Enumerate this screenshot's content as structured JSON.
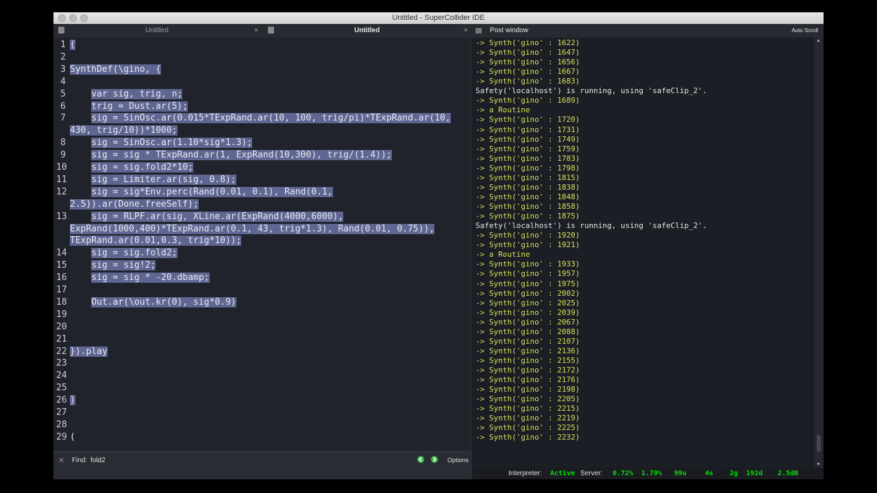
{
  "window": {
    "title": "Untitled - SuperCollider IDE"
  },
  "tabs": [
    {
      "label": "Untitled",
      "close": "×"
    },
    {
      "label": "Untitled",
      "close": "×"
    }
  ],
  "editor": {
    "lines": [
      {
        "n": "1",
        "indent": "",
        "text": "("
      },
      {
        "n": "2",
        "indent": "",
        "text": ""
      },
      {
        "n": "3",
        "indent": "",
        "text": "SynthDef(\\gino, {"
      },
      {
        "n": "4",
        "indent": "",
        "text": ""
      },
      {
        "n": "5",
        "indent": "    ",
        "text": "var sig, trig, n;"
      },
      {
        "n": "6",
        "indent": "    ",
        "text": "trig = Dust.ar(5);"
      },
      {
        "n": "7",
        "indent": "    ",
        "text": "sig = SinOsc.ar(0.015*TExpRand.ar(10, 100, trig/pi)*TExpRand.ar(10,"
      },
      {
        "n": "",
        "indent": "",
        "text": "430, trig/10))*1000;"
      },
      {
        "n": "8",
        "indent": "    ",
        "text": "sig = SinOsc.ar(1.10*sig*1.3);"
      },
      {
        "n": "9",
        "indent": "    ",
        "text": "sig = sig * TExpRand.ar(1, ExpRand(10,300), trig/(1.4));"
      },
      {
        "n": "10",
        "indent": "    ",
        "text": "sig = sig.fold2*10;"
      },
      {
        "n": "11",
        "indent": "    ",
        "text": "sig = Limiter.ar(sig, 0.8);"
      },
      {
        "n": "12",
        "indent": "    ",
        "text": "sig = sig*Env.perc(Rand(0.01, 0.1), Rand(0.1,"
      },
      {
        "n": "",
        "indent": "",
        "text": "2.5)).ar(Done.freeSelf);"
      },
      {
        "n": "13",
        "indent": "    ",
        "text": "sig = RLPF.ar(sig, XLine.ar(ExpRand(4000,6000),"
      },
      {
        "n": "",
        "indent": "",
        "text": "ExpRand(1000,400)*TExpRand.ar(0.1, 43, trig*1.3), Rand(0.01, 0.75)),"
      },
      {
        "n": "",
        "indent": "",
        "text": "TExpRand.ar(0.01,0.3, trig*10));"
      },
      {
        "n": "14",
        "indent": "    ",
        "text": "sig = sig.fold2;"
      },
      {
        "n": "15",
        "indent": "    ",
        "text": "sig = sig!2;"
      },
      {
        "n": "16",
        "indent": "    ",
        "text": "sig = sig * -20.dbamp;"
      },
      {
        "n": "17",
        "indent": "    ",
        "text": ""
      },
      {
        "n": "18",
        "indent": "    ",
        "text": "Out.ar(\\out.kr(0), sig*0.9)"
      },
      {
        "n": "19",
        "indent": "    ",
        "text": ""
      },
      {
        "n": "20",
        "indent": "    ",
        "text": ""
      },
      {
        "n": "21",
        "indent": "    ",
        "text": ""
      },
      {
        "n": "22",
        "indent": "",
        "text": "}).play"
      },
      {
        "n": "23",
        "indent": "",
        "text": ""
      },
      {
        "n": "24",
        "indent": "",
        "text": ""
      },
      {
        "n": "25",
        "indent": "",
        "text": ""
      },
      {
        "n": "26",
        "indent": "",
        "text": ")"
      },
      {
        "n": "27",
        "indent": "",
        "text": ""
      },
      {
        "n": "28",
        "indent": "",
        "text": ""
      },
      {
        "n": "29",
        "indent": "",
        "text": "("
      }
    ]
  },
  "find": {
    "label": "Find:",
    "value": "fold2",
    "options_label": "Options"
  },
  "post": {
    "title": "Post window",
    "auto_scroll": "Auto Scroll",
    "lines": [
      "-> Synth('gino' : 1622)",
      "-> Synth('gino' : 1647)",
      "-> Synth('gino' : 1656)",
      "-> Synth('gino' : 1667)",
      "-> Synth('gino' : 1683)",
      "Safety('localhost') is running, using 'safeClip_2'.",
      "-> Synth('gino' : 1689)",
      "-> a Routine",
      "-> Synth('gino' : 1720)",
      "-> Synth('gino' : 1731)",
      "-> Synth('gino' : 1749)",
      "-> Synth('gino' : 1759)",
      "-> Synth('gino' : 1783)",
      "-> Synth('gino' : 1798)",
      "-> Synth('gino' : 1815)",
      "-> Synth('gino' : 1838)",
      "-> Synth('gino' : 1848)",
      "-> Synth('gino' : 1858)",
      "-> Synth('gino' : 1875)",
      "Safety('localhost') is running, using 'safeClip_2'.",
      "-> Synth('gino' : 1920)",
      "-> Synth('gino' : 1921)",
      "-> a Routine",
      "-> Synth('gino' : 1933)",
      "-> Synth('gino' : 1957)",
      "-> Synth('gino' : 1975)",
      "-> Synth('gino' : 2002)",
      "-> Synth('gino' : 2025)",
      "-> Synth('gino' : 2039)",
      "-> Synth('gino' : 2067)",
      "-> Synth('gino' : 2088)",
      "-> Synth('gino' : 2107)",
      "-> Synth('gino' : 2136)",
      "-> Synth('gino' : 2155)",
      "-> Synth('gino' : 2172)",
      "-> Synth('gino' : 2176)",
      "-> Synth('gino' : 2198)",
      "-> Synth('gino' : 2205)",
      "-> Synth('gino' : 2215)",
      "-> Synth('gino' : 2219)",
      "-> Synth('gino' : 2225)",
      "-> Synth('gino' : 2232)"
    ]
  },
  "status": {
    "interpreter_label": "Interpreter:",
    "interpreter_value": "Active",
    "server_label": "Server:",
    "avg_cpu": "0.72%",
    "peak_cpu": "1.79%",
    "ugens": "99u",
    "synths": "4s",
    "groups": "2g",
    "synthdefs": "192d",
    "volume": "2.5dB"
  },
  "colors": {
    "selection": "#5f6691",
    "synth_output": "#d4e157",
    "status_green": "#00e000"
  }
}
